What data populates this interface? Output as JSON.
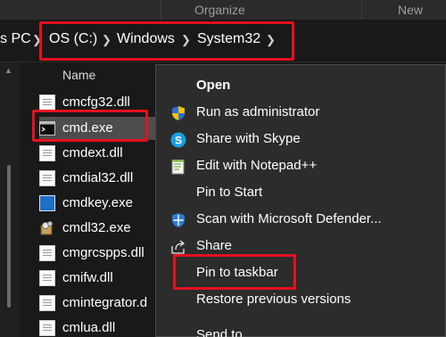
{
  "ribbon": {
    "organize": "Organize",
    "new": "New"
  },
  "breadcrumb": [
    "s PC",
    "OS (C:)",
    "Windows",
    "System32"
  ],
  "file_list": {
    "column_header": "Name",
    "files": [
      {
        "name": "cmcfg32.dll",
        "icon": "dll-file-icon"
      },
      {
        "name": "cmd.exe",
        "icon": "console-app-icon"
      },
      {
        "name": "cmdext.dll",
        "icon": "dll-file-icon"
      },
      {
        "name": "cmdial32.dll",
        "icon": "dll-file-icon"
      },
      {
        "name": "cmdkey.exe",
        "icon": "app-window-icon"
      },
      {
        "name": "cmdl32.exe",
        "icon": "setup-app-icon"
      },
      {
        "name": "cmgrcspps.dll",
        "icon": "dll-file-icon"
      },
      {
        "name": "cmifw.dll",
        "icon": "dll-file-icon"
      },
      {
        "name": "cmintegrator.d",
        "icon": "dll-file-icon"
      },
      {
        "name": "cmlua.dll",
        "icon": "dll-file-icon"
      }
    ],
    "selected": "cmd.exe"
  },
  "context_menu": {
    "items": [
      {
        "label": "Open",
        "icon": ""
      },
      {
        "label": "Run as administrator",
        "icon": "uac-shield-icon"
      },
      {
        "label": "Share with Skype",
        "icon": "skype-icon"
      },
      {
        "label": "Edit with Notepad++",
        "icon": "notepad-plus-plus-icon"
      },
      {
        "label": "Pin to Start",
        "icon": ""
      },
      {
        "label": "Scan with Microsoft Defender...",
        "icon": "defender-shield-icon"
      },
      {
        "label": "Share",
        "icon": "share-icon"
      },
      {
        "label": "Pin to taskbar",
        "icon": ""
      },
      {
        "label": "Restore previous versions",
        "icon": ""
      },
      {
        "label": "Send to",
        "icon": ""
      }
    ]
  },
  "colors": {
    "highlight": "#e5101f",
    "menu_bg": "#2c2c2c",
    "selection_bg": "#4d4d4d",
    "background": "#191919"
  }
}
